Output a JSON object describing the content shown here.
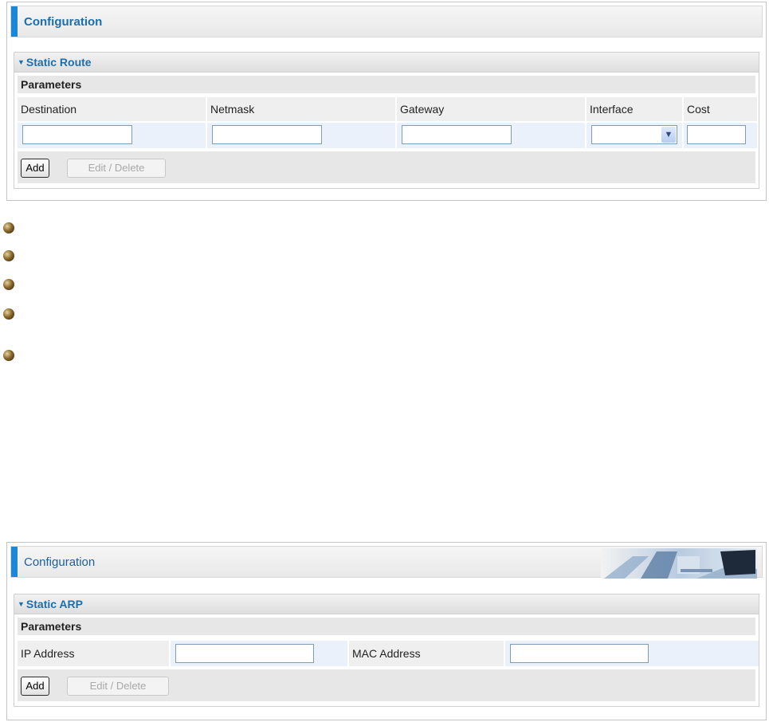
{
  "static_route": {
    "header": "Configuration",
    "section_title": "Static Route",
    "params_label": "Parameters",
    "columns": [
      "Destination",
      "Netmask",
      "Gateway",
      "Interface",
      "Cost"
    ],
    "destination": "",
    "netmask": "",
    "gateway": "",
    "interface": "",
    "cost": "",
    "add_label": "Add",
    "edit_delete_label": "Edit / Delete"
  },
  "bullets": [
    "bullet-icon",
    "bullet-icon",
    "bullet-icon",
    "bullet-icon",
    "bullet-icon"
  ],
  "static_arp": {
    "header": "Configuration",
    "section_title": "Static ARP",
    "params_label": "Parameters",
    "ip_label": "IP Address",
    "mac_label": "MAC Address",
    "ip_value": "",
    "mac_value": "",
    "add_label": "Add",
    "edit_delete_label": "Edit / Delete"
  },
  "colors": {
    "accent": "#1a88d6",
    "title": "#1a6fb0",
    "input_cell": "#eaf1fb"
  }
}
